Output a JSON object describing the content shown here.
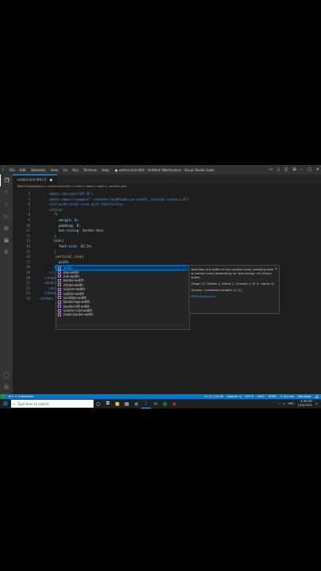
{
  "titlebar": {
    "menu": [
      "File",
      "Edit",
      "Selection",
      "View",
      "Go",
      "Run",
      "Terminal",
      "Help"
    ],
    "title": "● vertica line.html - Untitled (Workspace) - Visual Studio Code"
  },
  "tab": {
    "label": "vertica line.html 2",
    "close": "●"
  },
  "breadcrumbs": "Web Development  >  vertica line.html  >  html  >  head  >  style  >  .vertical_line",
  "code": [
    {
      "n": "4",
      "t": "<meta charset=\"UTF-8\">"
    },
    {
      "n": "5",
      "t": "<meta name=\"viewport\" content=\"width=device-width, initial-scale=1.0\">"
    },
    {
      "n": "6",
      "t": "<title>Vertical Line with CSS</title>"
    },
    {
      "n": "7",
      "t": "<style>"
    },
    {
      "n": "8",
      "t": "*{"
    },
    {
      "n": "9",
      "t": "margin: 0;"
    },
    {
      "n": "10",
      "t": "padding: 0;"
    },
    {
      "n": "11",
      "t": "box-sizing: border-box;"
    },
    {
      "n": "12",
      "t": "}"
    },
    {
      "n": "13",
      "t": "html{"
    },
    {
      "n": "14",
      "t": "font-size: 62.5%;"
    },
    {
      "n": "15",
      "t": "}"
    },
    {
      "n": "16",
      "t": ".vertical_line{"
    },
    {
      "n": "17",
      "t": "width"
    },
    {
      "n": "18",
      "t": "}"
    },
    {
      "n": "19",
      "t": "</style>"
    },
    {
      "n": "20",
      "t": "</head>"
    },
    {
      "n": "21",
      "t": "<body>"
    },
    {
      "n": "22",
      "t": "<div class=\"v"
    },
    {
      "n": "23",
      "t": "</body>"
    },
    {
      "n": "24",
      "t": "</html>"
    }
  ],
  "suggestions": [
    {
      "match": "width",
      "rest": ""
    },
    {
      "match": "",
      "rest": "box-width"
    },
    {
      "match": "",
      "rest": "min-width"
    },
    {
      "match": "",
      "rest": "border-width"
    },
    {
      "match": "",
      "rest": "stroke-width"
    },
    {
      "match": "",
      "rest": "column-width"
    },
    {
      "match": "",
      "rest": "outline-width"
    },
    {
      "match": "",
      "rest": "scrollbar-width"
    },
    {
      "match": "",
      "rest": "border-top-width"
    },
    {
      "match": "",
      "rest": "border-left-width"
    },
    {
      "match": "",
      "rest": "column-rule-width"
    },
    {
      "match": "",
      "rest": "mask-border-width"
    }
  ],
  "docs": {
    "desc": "Specifies the width of the content area, padding area or border area (depending on 'box-sizing') of certain boxes.",
    "browsers": "(Edge 12, Firefox 1, Safari 1, Chrome 1, IE 4, Opera 3)",
    "syntax": "Syntax: <viewport-length>{1,2}",
    "link": "MDN Reference",
    "close": "×"
  },
  "statusbar": {
    "left": "⊗ 0  ⚠ 0     Blackbox",
    "items": [
      "Ln 17, Col 18",
      "Spaces: 4",
      "UTF-8",
      "CRLF",
      "HTML",
      "⊙ Go Live",
      "Blackbox"
    ]
  },
  "taskbar": {
    "search_placeholder": "Type here to search",
    "lang": "ENG",
    "time": "4:38 PM",
    "date": "7/16/2023"
  }
}
